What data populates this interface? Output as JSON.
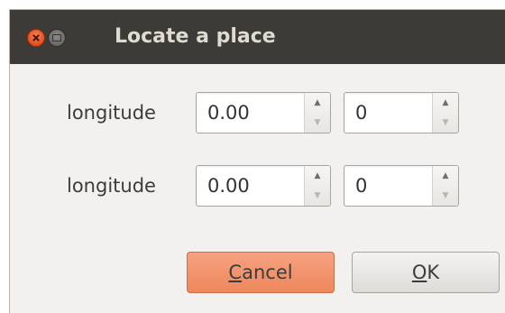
{
  "window": {
    "title": "Locate a place"
  },
  "rows": [
    {
      "label": "longitude",
      "value": "0.00",
      "value2": "0"
    },
    {
      "label": "longitude",
      "value": "0.00",
      "value2": "0"
    }
  ],
  "buttons": {
    "cancel": {
      "mnemonic": "C",
      "rest": "ancel"
    },
    "ok": {
      "mnemonic": "O",
      "rest": "K"
    }
  },
  "icons": {
    "close": "close-icon",
    "minimize": "minimize-icon",
    "spin_up": "spin-up-icon",
    "spin_down": "spin-down-icon"
  },
  "colors": {
    "titlebar": "#3c3b37",
    "close_button": "#e95420",
    "cancel_button": "#ee875d",
    "dialog_bg": "#f2f1f0"
  }
}
